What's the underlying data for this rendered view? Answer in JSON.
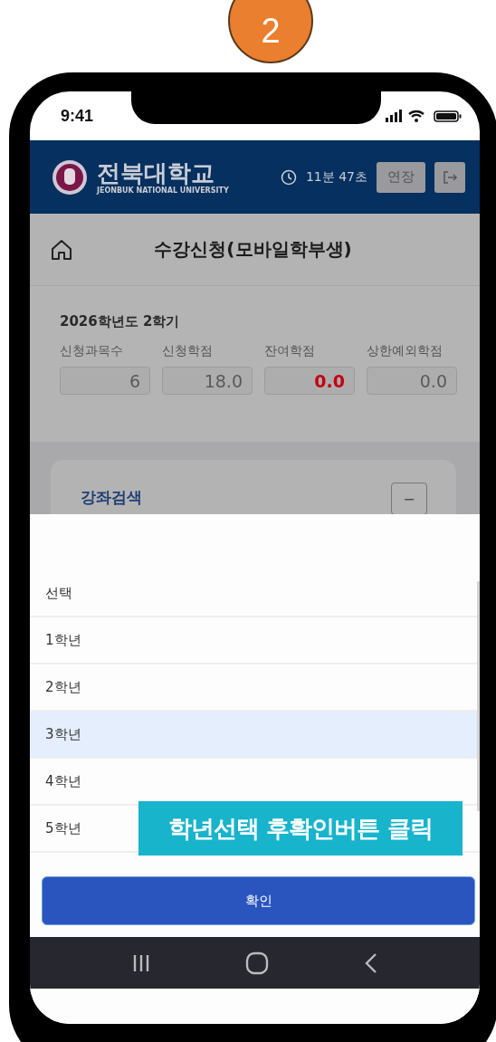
{
  "step_badge": "2",
  "status_bar": {
    "time": "9:41"
  },
  "header": {
    "logo_title": "전북대학교",
    "logo_subtitle": "JEONBUK NATIONAL UNIVERSITY",
    "timer": "11분 47초",
    "extend_button": "연장"
  },
  "page_title": "수강신청(모바일학부생)",
  "summary": {
    "term": "2026학년도 2학기",
    "fields": [
      {
        "label": "신청과목수",
        "value": "6",
        "highlight": false
      },
      {
        "label": "신청학점",
        "value": "18.0",
        "highlight": false
      },
      {
        "label": "잔여학점",
        "value": "0.0",
        "highlight": true
      },
      {
        "label": "상한예외학점",
        "value": "0.0",
        "highlight": false
      }
    ]
  },
  "section": {
    "title": "강좌검색",
    "toggle": "−"
  },
  "picker": {
    "options": [
      {
        "label": "선택",
        "selected": false
      },
      {
        "label": "1학년",
        "selected": false
      },
      {
        "label": "2학년",
        "selected": false
      },
      {
        "label": "3학년",
        "selected": true
      },
      {
        "label": "4학년",
        "selected": false
      },
      {
        "label": "5학년",
        "selected": false
      }
    ],
    "confirm_button": "확인"
  },
  "callout": "학년선택 후확인버튼 클릭"
}
